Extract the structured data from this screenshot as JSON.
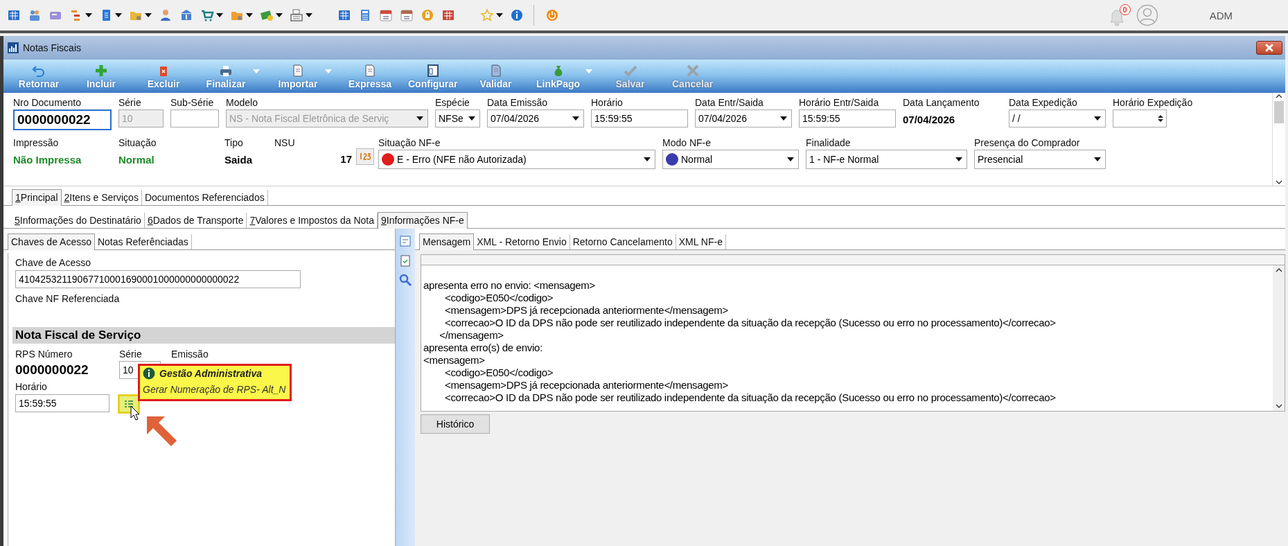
{
  "app_toolbar": {
    "groups": [
      {
        "items": [
          {
            "kind": "building",
            "dropdown": false
          },
          {
            "kind": "people",
            "dropdown": false
          },
          {
            "kind": "card",
            "dropdown": false
          },
          {
            "kind": "hierarchy",
            "dropdown": true
          },
          {
            "kind": "document",
            "dropdown": true
          },
          {
            "kind": "folder-gear",
            "dropdown": true
          },
          {
            "kind": "person",
            "dropdown": false
          },
          {
            "kind": "bank",
            "dropdown": false
          },
          {
            "kind": "cart",
            "dropdown": true
          },
          {
            "kind": "folder",
            "dropdown": true
          },
          {
            "kind": "money",
            "dropdown": true
          },
          {
            "kind": "register",
            "dropdown": true
          }
        ]
      },
      {
        "items": [
          {
            "kind": "grid",
            "dropdown": false
          },
          {
            "kind": "calculator",
            "dropdown": false
          },
          {
            "kind": "calendar",
            "dropdown": false
          },
          {
            "kind": "calendar-gear",
            "dropdown": false
          },
          {
            "kind": "lock",
            "dropdown": false
          },
          {
            "kind": "report",
            "dropdown": false
          }
        ]
      },
      {
        "items": [
          {
            "kind": "star",
            "dropdown": true
          },
          {
            "kind": "info",
            "dropdown": false
          }
        ]
      },
      {
        "items": [
          {
            "kind": "power",
            "dropdown": false
          }
        ]
      }
    ],
    "notifications": "0",
    "user": "ADM"
  },
  "window": {
    "title": "Notas Fiscais"
  },
  "ribbon": [
    {
      "label": "Retornar",
      "kind": "undo",
      "dropdown": false,
      "disabled": false
    },
    {
      "label": "Incluir",
      "kind": "plus",
      "dropdown": false,
      "disabled": false
    },
    {
      "label": "Excluir",
      "kind": "trash",
      "dropdown": false,
      "disabled": false
    },
    {
      "label": "Finalizar",
      "kind": "printer",
      "dropdown": true,
      "disabled": false
    },
    {
      "label": "Importar",
      "kind": "document",
      "dropdown": true,
      "disabled": false
    },
    {
      "label": "Expressa",
      "kind": "document",
      "dropdown": false,
      "disabled": false
    },
    {
      "label": "Configurar",
      "kind": "window",
      "dropdown": false,
      "disabled": false
    },
    {
      "label": "Validar",
      "kind": "validate",
      "dropdown": false,
      "disabled": false
    },
    {
      "label": "LinkPago",
      "kind": "money-bag",
      "dropdown": true,
      "disabled": false
    },
    {
      "label": "Salvar",
      "kind": "check",
      "dropdown": false,
      "disabled": true
    },
    {
      "label": "Cancelar",
      "kind": "cross",
      "dropdown": false,
      "disabled": true
    }
  ],
  "header": {
    "row1": [
      {
        "label": "Nro Documento",
        "kind": "input",
        "value": "0000000022",
        "focused": true,
        "disabled": false
      },
      {
        "label": "Série",
        "kind": "input",
        "value": "10",
        "focused": false,
        "disabled": true
      },
      {
        "label": "Sub-Série",
        "kind": "input",
        "focused": false,
        "disabled": false
      },
      {
        "label": "Modelo",
        "kind": "select",
        "value": "NS - Nota Fiscal Eletrônica de Serviç",
        "focused": false,
        "disabled": true
      },
      {
        "label": "Espécie",
        "kind": "select",
        "value": "NFSe",
        "focused": false,
        "disabled": false
      },
      {
        "label": "Data Emissão",
        "kind": "select",
        "value": "07/04/2026",
        "focused": false,
        "disabled": false
      },
      {
        "label": "Horário",
        "kind": "input",
        "value": "15:59:55",
        "focused": false,
        "disabled": false
      },
      {
        "label": "Data Entr/Saida",
        "kind": "select",
        "value": "07/04/2026",
        "focused": false,
        "disabled": false
      },
      {
        "label": "Horário Entr/Saida",
        "kind": "input",
        "value": "15:59:55",
        "focused": false,
        "disabled": false
      },
      {
        "label": "Data Lançamento",
        "kind": "static",
        "value": "07/04/2026"
      },
      {
        "label": "Data Expedição",
        "kind": "select",
        "value": " / /",
        "focused": false,
        "disabled": false
      },
      {
        "label": "Horário Expedição",
        "kind": "spinner",
        "focused": false,
        "disabled": false
      }
    ],
    "row2": [
      {
        "label": "Impressão",
        "kind": "status",
        "value": "Não Impressa"
      },
      {
        "label": "Situação",
        "kind": "status",
        "value": "Normal"
      },
      {
        "label": "Tipo",
        "kind": "static",
        "value": "Saida"
      },
      {
        "label": "NSU",
        "kind": "counter",
        "value": "17"
      },
      {
        "label": "Situação NF-e",
        "kind": "dot-select",
        "value": "E - Erro (NFE não Autorizada)",
        "color": "#e21b1b"
      },
      {
        "label": "Modo NF-e",
        "kind": "dot-select",
        "value": "Normal",
        "color": "#3b3bb0"
      },
      {
        "label": "Finalidade",
        "kind": "select",
        "value": "1 - NF-e Normal"
      },
      {
        "label": "Presença do Comprador",
        "kind": "select",
        "value": "Presencial"
      }
    ]
  },
  "tabs": [
    {
      "key": "1",
      "label": "Principal",
      "selected": true
    },
    {
      "key": "2",
      "label": "Itens e Serviços",
      "selected": false
    },
    {
      "label": "Documentos Referenciados",
      "selected": false
    }
  ],
  "subtabs": [
    {
      "key": "5",
      "label": "Informações do Destinatário",
      "selected": false
    },
    {
      "key": "6",
      "label": "Dados de Transporte",
      "selected": false
    },
    {
      "key": "7",
      "label": "Valores e Impostos da Nota",
      "selected": false
    },
    {
      "key": "9",
      "label": "Informações NF-e",
      "selected": true
    }
  ],
  "left_panel": {
    "tabs": [
      {
        "label": "Chaves de Acesso",
        "selected": true
      },
      {
        "label": "Notas Referênciadas",
        "selected": false
      }
    ],
    "access_key_label": "Chave de Acesso",
    "access_key": "41042532119067710001690001000000000000022",
    "referenced_label": "Chave NF Referenciada",
    "section": "Nota Fiscal de Serviço",
    "rps_label": "RPS Número",
    "rps_value": "0000000022",
    "serie_label": "Série",
    "serie_value": "10",
    "emissao_label": "Emissão",
    "horario_label": "Horário",
    "horario_value": "15:59:55",
    "tooltip": {
      "title": "Gestão Administrativa",
      "text": "Gerar Numeração de RPS- Alt_N"
    }
  },
  "right_panel": {
    "tabs": [
      {
        "label": "Mensagem",
        "selected": true
      },
      {
        "label": "XML - Retorno Envio",
        "selected": false
      },
      {
        "label": "Retorno Cancelamento",
        "selected": false
      },
      {
        "label": "XML NF-e",
        "selected": false
      }
    ],
    "message": "apresenta erro no envio: <mensagem>\n\t<codigo>E050</codigo>\n\t<mensagem>DPS já recepcionada anteriormente</mensagem>\n\t<correcao>O ID da DPS não pode ser reutilizado independente da situação da recepção (Sucesso ou erro no processamento)</correcao>\n      </mensagem>\napresenta erro(s) de envio:\n<mensagem>\n\t<codigo>E050</codigo>\n\t<mensagem>DPS já recepcionada anteriormente</mensagem>\n\t<correcao>O ID da DPS não pode ser reutilizado independente da situação da recepção (Sucesso ou erro no processamento)</correcao>",
    "history_button": "Histórico"
  }
}
